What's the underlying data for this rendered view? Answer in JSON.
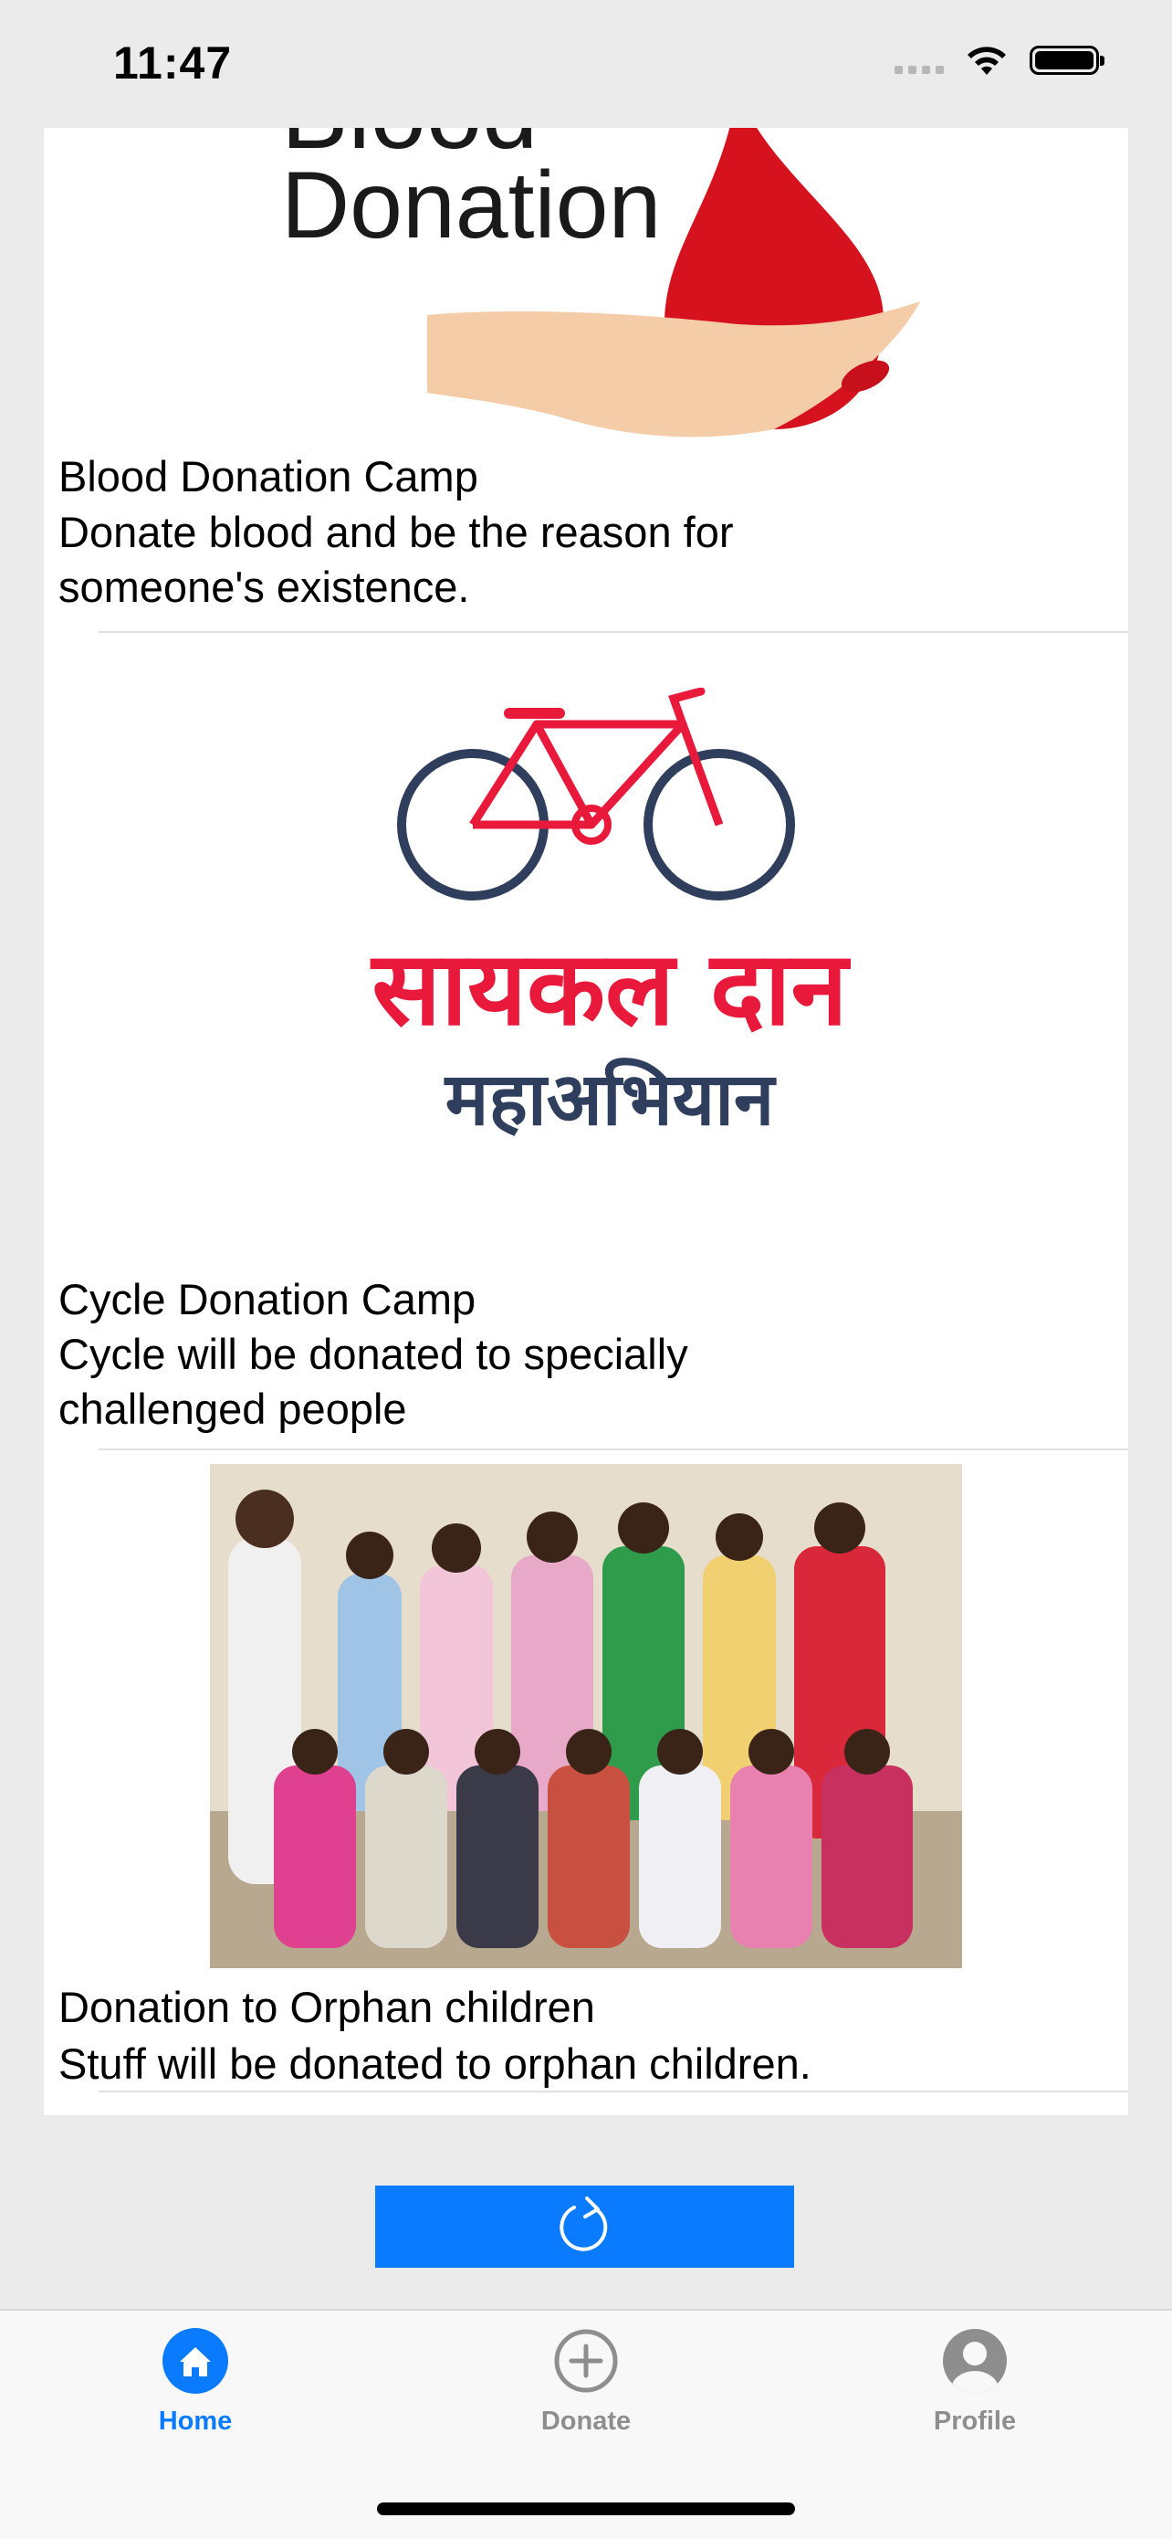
{
  "status_bar": {
    "time": "11:47"
  },
  "list": {
    "items": [
      {
        "image_text_line1": "Blood",
        "image_text_line2": "Donation",
        "title": "Blood Donation Camp",
        "description": "Donate blood and be the reason for someone's existence."
      },
      {
        "image_text_line1": "सायकल दान",
        "image_text_line2": "महाअभियान",
        "title": "Cycle Donation Camp",
        "description": "Cycle will be donated to specially challenged people"
      },
      {
        "title": "Donation to Orphan children",
        "description": "Stuff will be donated to orphan children."
      }
    ]
  },
  "tab_bar": {
    "tabs": [
      {
        "label": "Home",
        "icon": "house-icon",
        "selected": true
      },
      {
        "label": "Donate",
        "icon": "plus-circle-icon",
        "selected": false
      },
      {
        "label": "Profile",
        "icon": "person-circle-icon",
        "selected": false
      }
    ]
  },
  "colors": {
    "accent": "#0a7bff",
    "inactive_tab": "#8e8e8e",
    "blood_red": "#d6121e",
    "cycle_red": "#e8193b",
    "cycle_navy": "#2e3e5c"
  }
}
